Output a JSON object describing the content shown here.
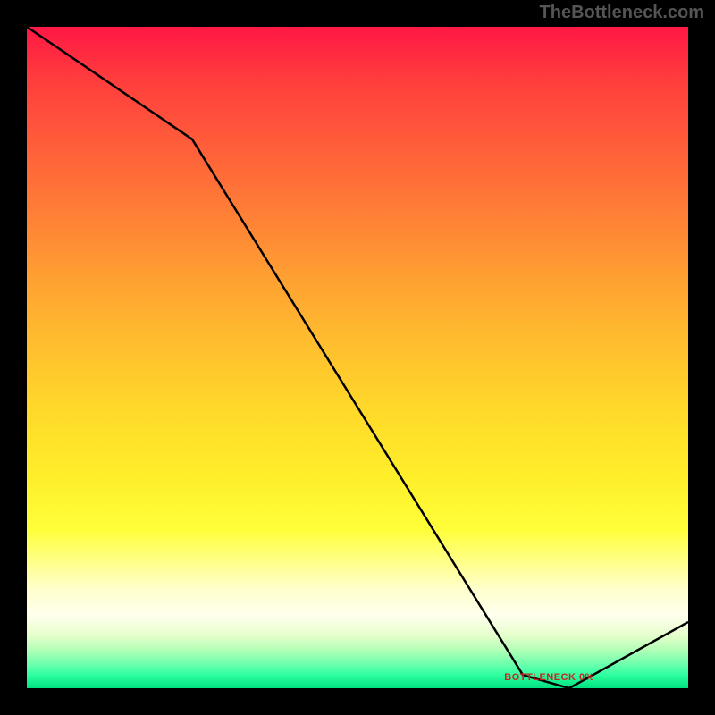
{
  "watermark_text": "TheBottleneck.com",
  "bottleneck_label": "BOTTLENECK 0%",
  "chart_data": {
    "type": "line",
    "title": "",
    "xlabel": "",
    "ylabel": "",
    "xlim": [
      0,
      100
    ],
    "ylim": [
      0,
      100
    ],
    "x": [
      0,
      25,
      75,
      82,
      100
    ],
    "y": [
      100,
      83,
      2,
      0,
      10
    ],
    "notch_x": 79,
    "background_gradient": "red-to-green (top-to-bottom)"
  },
  "colors": {
    "plot_border": "#000000",
    "line_color": "#000000",
    "background": "#000000",
    "watermark": "#555555",
    "label_color": "#d02020"
  }
}
